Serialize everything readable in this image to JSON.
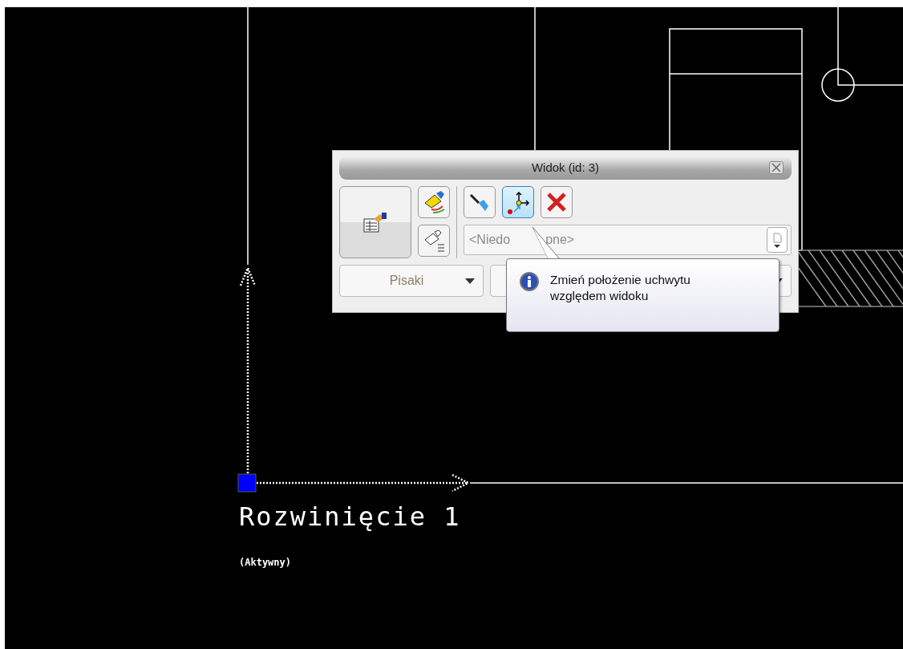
{
  "canvas": {
    "view_label": "Rozwinięcie 1",
    "view_status": "(Aktywny)"
  },
  "panel": {
    "title": "Widok (id: 3)",
    "toolbar": [
      {
        "kind": "draw",
        "selected": false
      },
      {
        "kind": "move-handle",
        "selected": true
      },
      {
        "kind": "delete",
        "selected": false
      }
    ],
    "combo": {
      "value_start": "<Niedo",
      "value_end": "pne>"
    },
    "dropdown": {
      "label": "Pisaki"
    }
  },
  "tooltip": {
    "text": "Zmień położenie uchwytu względem widoku"
  }
}
